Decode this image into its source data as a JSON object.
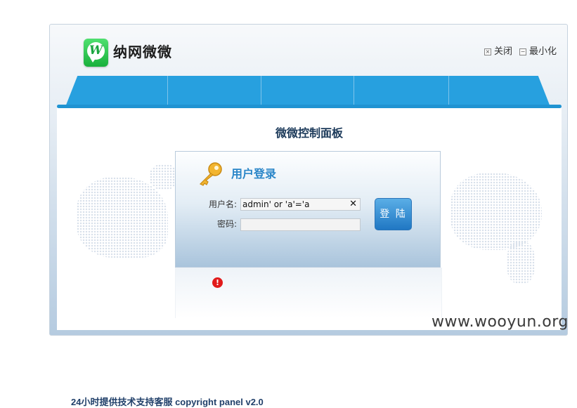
{
  "header": {
    "logo_glyph": "W",
    "brand_name": "纳网微微",
    "close_label": "关闭",
    "minimize_label": "最小化",
    "close_box": "×",
    "minimize_box": "−"
  },
  "panel": {
    "title": "微微控制面板"
  },
  "login": {
    "title": "用户登录",
    "username_label": "用户名:",
    "username_value": "admin' or 'a'='a",
    "clear_symbol": "✕",
    "password_label": "密码:",
    "password_value": "",
    "submit_label": "登 陆"
  },
  "error_icon_glyph": "!",
  "footer": {
    "text": "24小时提供技术支持客服 copyright panel v2.0"
  },
  "watermark": "www.wooyun.org",
  "colors": {
    "nav_blue": "#27a0df",
    "title_blue": "#2a86c8",
    "error_red": "#e11b1b",
    "logo_green": "#19b03c"
  },
  "icons": [
    "key-icon",
    "error-icon",
    "close-box-icon",
    "minimize-box-icon"
  ]
}
